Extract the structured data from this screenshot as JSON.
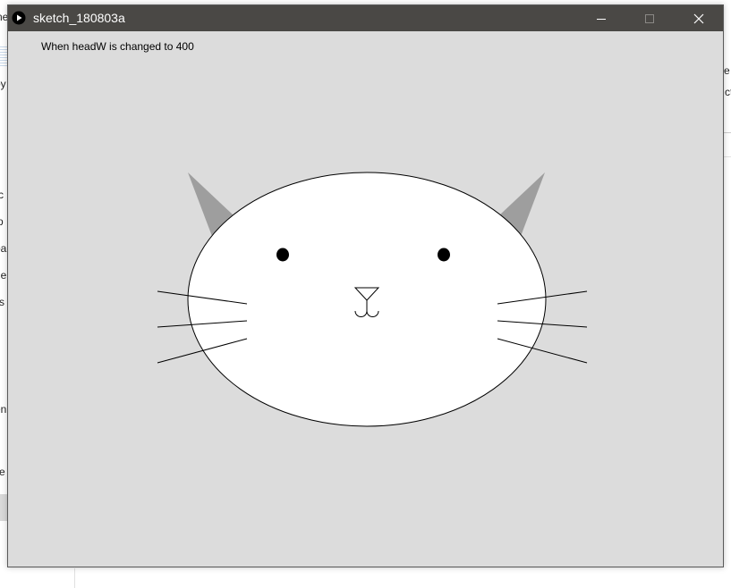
{
  "window": {
    "title": "sketch_180803a",
    "title_bar_color": "#4a4845",
    "canvas_background": "#dcdcdc"
  },
  "background_window": {
    "fragments": [
      "ne",
      "oy",
      "c",
      "p",
      "oa",
      "ne",
      "s",
      "en",
      "e",
      "e",
      "ct"
    ]
  },
  "sketch": {
    "caption": "When headW is changed to 400",
    "head_color": "#ffffff",
    "ear_color": "#9e9e9e",
    "eye_color": "#000000",
    "stroke_color": "#000000"
  },
  "icons": {
    "app": "play-icon",
    "minimize": "minimize-icon",
    "maximize": "maximize-icon",
    "close": "close-icon"
  }
}
